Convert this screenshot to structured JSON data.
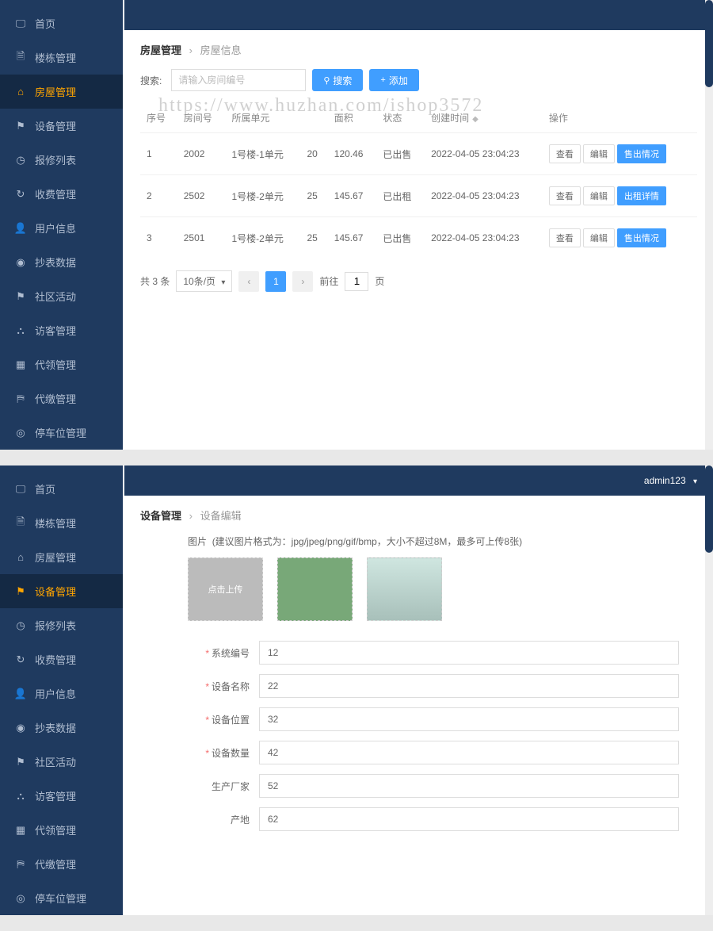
{
  "watermark": "https://www.huzhan.com/ishop3572",
  "sidebar": {
    "items": [
      {
        "label": "首页",
        "icon": "monitor"
      },
      {
        "label": "楼栋管理",
        "icon": "doc"
      },
      {
        "label": "房屋管理",
        "icon": "house"
      },
      {
        "label": "设备管理",
        "icon": "flag"
      },
      {
        "label": "报修列表",
        "icon": "clock"
      },
      {
        "label": "收费管理",
        "icon": "repeat"
      },
      {
        "label": "用户信息",
        "icon": "user"
      },
      {
        "label": "抄表数据",
        "icon": "meter"
      },
      {
        "label": "社区活动",
        "icon": "flag"
      },
      {
        "label": "访客管理",
        "icon": "visitor"
      },
      {
        "label": "代领管理",
        "icon": "grid"
      },
      {
        "label": "代缴管理",
        "icon": "pay"
      },
      {
        "label": "停车位管理",
        "icon": "park"
      }
    ]
  },
  "panel1": {
    "activeSidebarIndex": 2,
    "breadcrumb": {
      "main": "房屋管理",
      "sub": "房屋信息"
    },
    "search": {
      "label": "搜索:",
      "placeholder": "请输入房间编号",
      "searchBtn": "搜索",
      "addBtn": "添加"
    },
    "table": {
      "headers": [
        "序号",
        "房间号",
        "所属单元",
        "",
        "面积",
        "状态",
        "创建时间",
        "操作"
      ],
      "sortColumn": "创建时间",
      "rows": [
        {
          "idx": "1",
          "room": "2002",
          "unit": "1号楼-1单元",
          "num": "20",
          "area": "120.46",
          "status": "已出售",
          "time": "2022-04-05 23:04:23",
          "actions": [
            "查看",
            "编辑",
            "售出情况"
          ]
        },
        {
          "idx": "2",
          "room": "2502",
          "unit": "1号楼-2单元",
          "num": "25",
          "area": "145.67",
          "status": "已出租",
          "time": "2022-04-05 23:04:23",
          "actions": [
            "查看",
            "编辑",
            "出租详情"
          ]
        },
        {
          "idx": "3",
          "room": "2501",
          "unit": "1号楼-2单元",
          "num": "25",
          "area": "145.67",
          "status": "已出售",
          "time": "2022-04-05 23:04:23",
          "actions": [
            "查看",
            "编辑",
            "售出情况"
          ]
        }
      ]
    },
    "pagination": {
      "total": "共 3 条",
      "pageSize": "10条/页",
      "current": "1",
      "gotoLabel": "前往",
      "gotoVal": "1",
      "gotoSuffix": "页"
    }
  },
  "panel2": {
    "activeSidebarIndex": 3,
    "user": "admin123",
    "breadcrumb": {
      "main": "设备管理",
      "sub": "设备编辑"
    },
    "upload": {
      "label": "图片",
      "hint": "(建议图片格式为：jpg/jpeg/png/gif/bmp，大小不超过8M，最多可上传8张)",
      "placeholder": "点击上传"
    },
    "form": [
      {
        "label": "系统编号",
        "value": "12",
        "required": true
      },
      {
        "label": "设备名称",
        "value": "22",
        "required": true
      },
      {
        "label": "设备位置",
        "value": "32",
        "required": true
      },
      {
        "label": "设备数量",
        "value": "42",
        "required": true
      },
      {
        "label": "生产厂家",
        "value": "52",
        "required": false
      },
      {
        "label": "产地",
        "value": "62",
        "required": false
      }
    ]
  }
}
